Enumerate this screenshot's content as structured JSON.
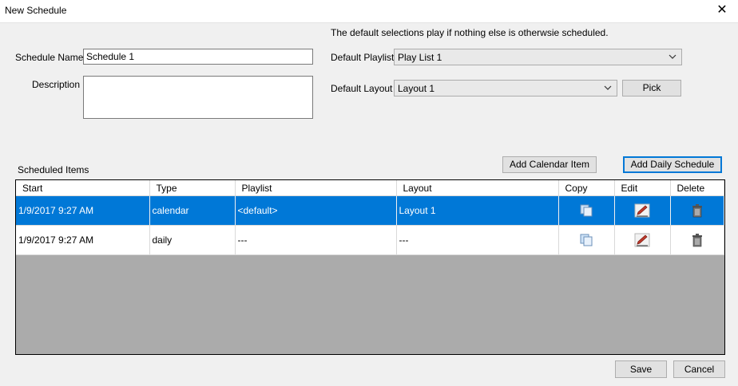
{
  "window": {
    "title": "New Schedule"
  },
  "form": {
    "schedule_name_label": "Schedule Name",
    "schedule_name_value": "Schedule 1",
    "description_label": "Description",
    "description_value": "",
    "hint_text": "The default selections play if nothing else is otherwsie scheduled.",
    "default_playlist_label": "Default Playlist",
    "default_playlist_value": "Play List 1",
    "default_layout_label": "Default Layout",
    "default_layout_value": "Layout 1",
    "pick_label": "Pick"
  },
  "scheduled": {
    "label": "Scheduled Items",
    "add_calendar_label": "Add Calendar Item",
    "add_daily_label": "Add Daily Schedule",
    "columns": [
      "Start",
      "Type",
      "Playlist",
      "Layout",
      "Copy",
      "Edit",
      "Delete"
    ],
    "rows": [
      {
        "start": "1/9/2017 9:27 AM",
        "type": "calendar",
        "playlist": "<default>",
        "layout": "Layout 1"
      },
      {
        "start": "1/9/2017 9:27 AM",
        "type": "daily",
        "playlist": "---",
        "layout": "---"
      }
    ]
  },
  "footer": {
    "save_label": "Save",
    "cancel_label": "Cancel"
  },
  "colors": {
    "selection": "#0078d7",
    "grid_bg": "#ababab",
    "focus": "#0078d7"
  }
}
